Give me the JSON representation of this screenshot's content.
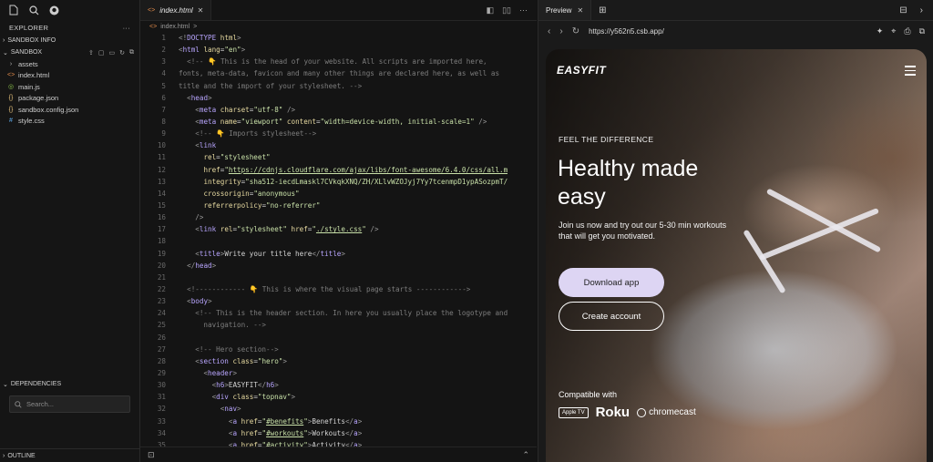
{
  "sidebar": {
    "explorer_title": "EXPLORER",
    "sandbox_info": "SANDBOX INFO",
    "sandbox": "SANDBOX",
    "files": [
      {
        "name": "assets",
        "icon": "chevron-right-icon",
        "glyph": "›"
      },
      {
        "name": "index.html",
        "icon": "html-file-icon",
        "glyph": "<>"
      },
      {
        "name": "main.js",
        "icon": "js-file-icon",
        "glyph": "◎"
      },
      {
        "name": "package.json",
        "icon": "json-file-icon",
        "glyph": "{}"
      },
      {
        "name": "sandbox.config.json",
        "icon": "json-file-icon",
        "glyph": "{}"
      },
      {
        "name": "style.css",
        "icon": "css-file-icon",
        "glyph": "#"
      }
    ],
    "dependencies": "DEPENDENCIES",
    "search_placeholder": "Search...",
    "outline": "OUTLINE"
  },
  "editor": {
    "tab_label": "index.html",
    "breadcrumb": "index.html",
    "breadcrumb_sep": ">"
  },
  "preview": {
    "tab_label": "Preview",
    "url": "https://y562n5.csb.app/",
    "site": {
      "logo": "EASYFIT",
      "eyebrow": "FEEL THE DIFFERENCE",
      "headline": "Healthy made easy",
      "subtext": "Join us now and try out our 5-30 min workouts that will get you motivated.",
      "btn_download": "Download app",
      "btn_create": "Create account",
      "compatible": "Compatible with",
      "partners": {
        "apple_tv": "Apple TV",
        "roku": "Roku",
        "chromecast": "chromecast"
      }
    }
  },
  "colors": {
    "accent_button": "#ddd5f3"
  }
}
